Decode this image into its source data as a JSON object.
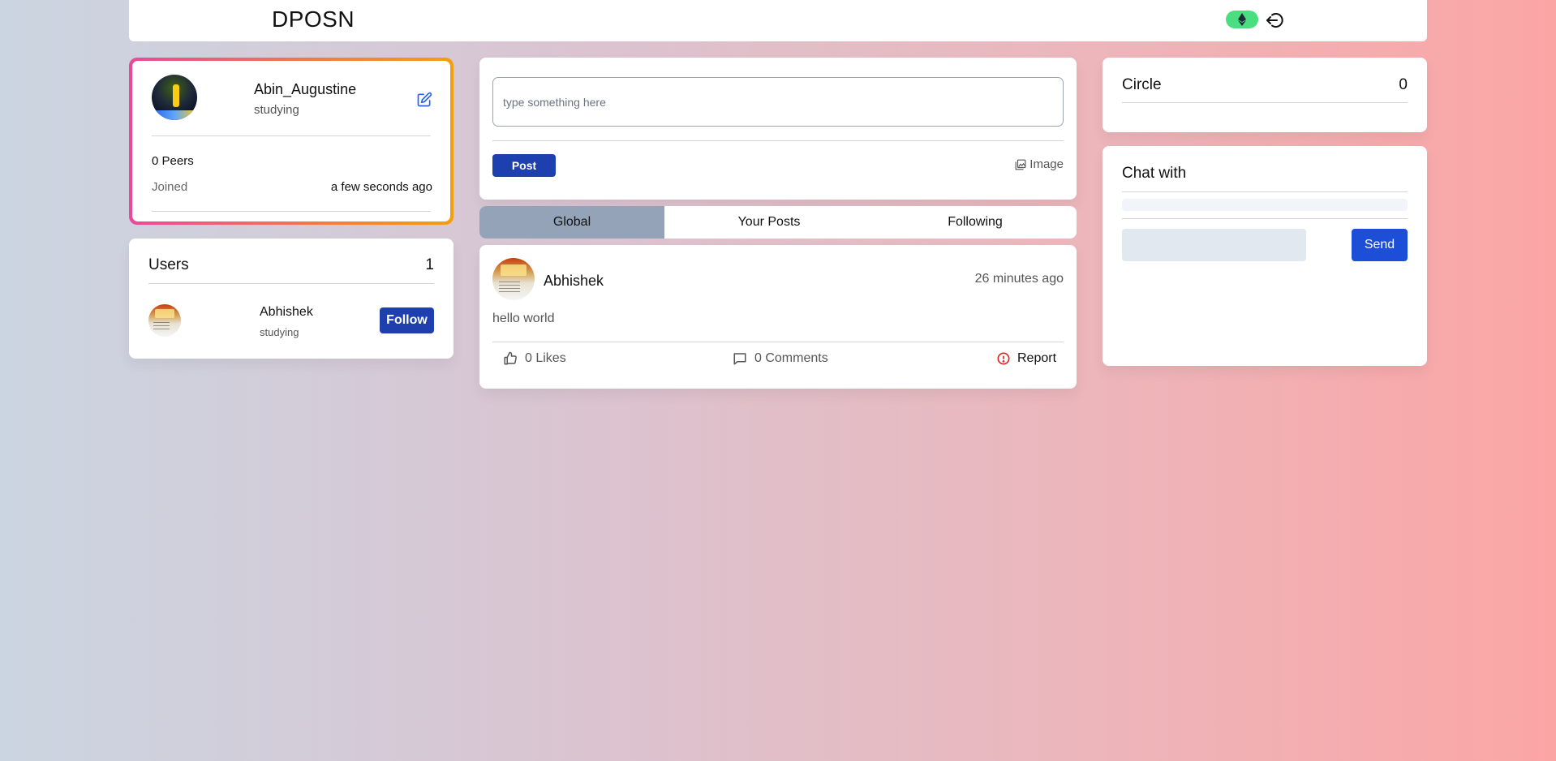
{
  "header": {
    "brand": "DPOSN",
    "wallet_icon": "ethereum-icon",
    "logout_icon": "logout-icon"
  },
  "profile": {
    "name": "Abin_Augustine",
    "status": "studying",
    "peers": "0 Peers",
    "joined_label": "Joined",
    "joined_value": "a few seconds ago",
    "edit_icon": "edit-icon"
  },
  "users": {
    "title": "Users",
    "count": "1",
    "items": [
      {
        "name": "Abhishek",
        "status": "studying",
        "action": "Follow"
      }
    ]
  },
  "composer": {
    "placeholder": "type something here",
    "post_label": "Post",
    "image_label": "Image"
  },
  "tabs": [
    {
      "label": "Global",
      "active": true
    },
    {
      "label": "Your Posts",
      "active": false
    },
    {
      "label": "Following",
      "active": false
    }
  ],
  "posts": [
    {
      "author": "Abhishek",
      "time": "26 minutes ago",
      "body": "hello world",
      "likes": "0 Likes",
      "comments": "0 Comments",
      "report": "Report"
    }
  ],
  "circle": {
    "title": "Circle",
    "count": "0"
  },
  "chat": {
    "title": "Chat with",
    "send_label": "Send"
  },
  "colors": {
    "primary_button": "#1e40af",
    "send_button": "#1d4ed8",
    "eth_pill": "#4ade80",
    "active_tab": "#94a3b8",
    "report_icon": "#dc2626",
    "edit_icon": "#2563eb"
  }
}
